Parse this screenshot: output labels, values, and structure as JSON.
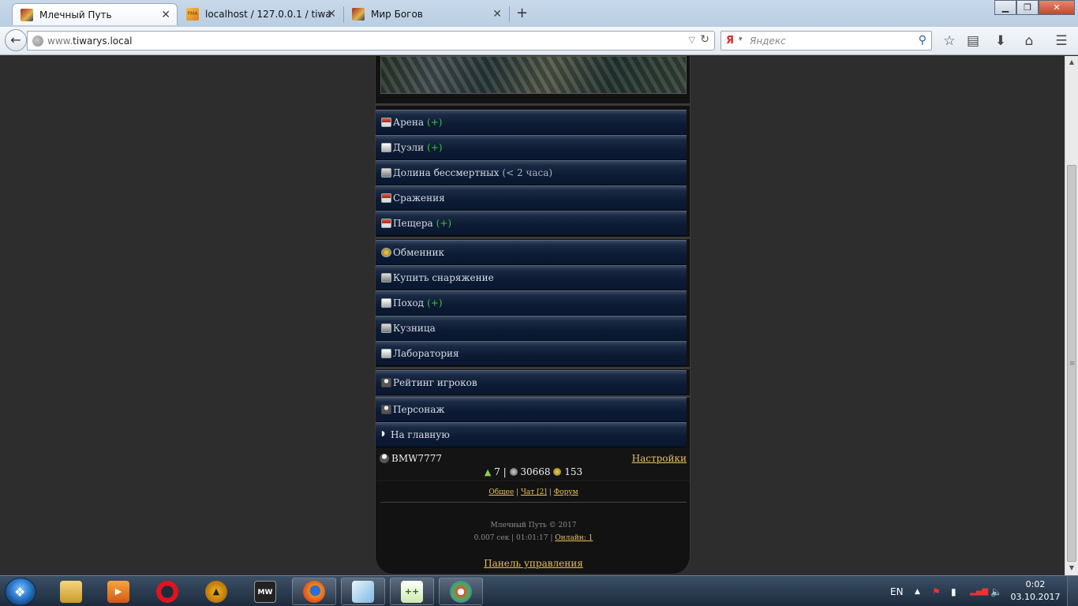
{
  "browser": {
    "tabs": [
      {
        "title": "Млечный Путь",
        "active": true
      },
      {
        "title": "localhost / 127.0.0.1 / tiwar...",
        "active": false
      },
      {
        "title": "Мир Богов",
        "active": false
      }
    ],
    "new_tab_symbol": "+",
    "url_host_prefix": "www.",
    "url_host": "tiwarys.local",
    "search_engine_glyph": "Я",
    "search_placeholder": "Яндекс"
  },
  "menu": {
    "group1": [
      {
        "label": "Арена",
        "extra": "(+)",
        "icon": "arena-icon"
      },
      {
        "label": "Дуэли",
        "extra": "(+)",
        "icon": "duel-icon"
      },
      {
        "label": "Долина бессмертных",
        "note": "(< 2 часа)",
        "icon": "valley-icon"
      },
      {
        "label": "Сражения",
        "icon": "battle-icon"
      },
      {
        "label": "Пещера",
        "extra": "(+)",
        "icon": "cave-icon"
      }
    ],
    "group2": [
      {
        "label": "Обменник",
        "icon": "coin-icon"
      },
      {
        "label": "Купить снаряжение",
        "icon": "armor-icon"
      },
      {
        "label": "Поход",
        "extra": "(+)",
        "icon": "campaign-icon"
      },
      {
        "label": "Кузница",
        "icon": "forge-icon"
      },
      {
        "label": "Лаборатория",
        "icon": "lab-icon"
      }
    ],
    "group3": [
      {
        "label": "Рейтинг игроков",
        "icon": "user-icon"
      }
    ],
    "group4": [
      {
        "label": "Персонаж",
        "icon": "user-icon"
      },
      {
        "label": "На главную",
        "icon": "arrow-icon"
      }
    ]
  },
  "user": {
    "name": "BMW7777",
    "settings_label": "Настройки",
    "level": "7",
    "silver": "30668",
    "gold": "153",
    "separator": "|"
  },
  "links": {
    "general": "Общее",
    "chat": "Чат [2]",
    "forum": "Форум",
    "sep": "|"
  },
  "footer": {
    "copyright": "Млечный Путь © 2017",
    "timing": "0.007 сек | 01:01:17 |",
    "online": "Онлайн: 1",
    "admin": "Панель управления"
  },
  "taskbar": {
    "lang": "EN",
    "time": "0:02",
    "date": "03.10.2017"
  }
}
